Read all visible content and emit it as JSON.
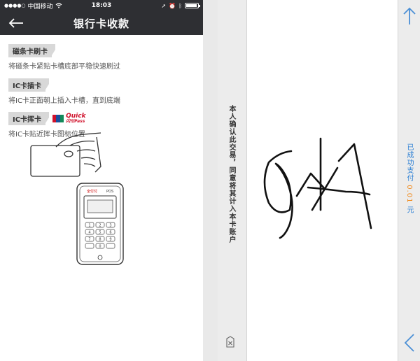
{
  "status_bar": {
    "carrier": "中国移动",
    "time": "18:03"
  },
  "nav": {
    "title": "银行卡收款"
  },
  "methods": [
    {
      "tag": "磁条卡刷卡",
      "desc": "将磁条卡紧贴卡槽底部平稳快速刷过"
    },
    {
      "tag": "IC卡插卡",
      "desc": "将IC卡正面朝上插入卡槽，直到底端"
    },
    {
      "tag": "IC卡挥卡",
      "desc": "将IC卡贴近挥卡图标位置"
    }
  ],
  "quickpass": {
    "line1": "Quick",
    "line2": "Pass",
    "cn": "闪付"
  },
  "pos": {
    "brand": "全付付",
    "model": "POS",
    "keys": [
      "1",
      "2",
      "3",
      "4",
      "5",
      "6",
      "7",
      "8",
      "9",
      "",
      "0",
      ""
    ]
  },
  "signature": {
    "consent_text": "本人确认此交易，同意将其计入本卡账户",
    "paid_prefix": "已成功支付",
    "paid_amount": "0.01",
    "paid_suffix": "元"
  },
  "colors": {
    "navbar": "#2e2f33",
    "blue_text": "#2b7fd4",
    "amount": "#f08a1c"
  }
}
